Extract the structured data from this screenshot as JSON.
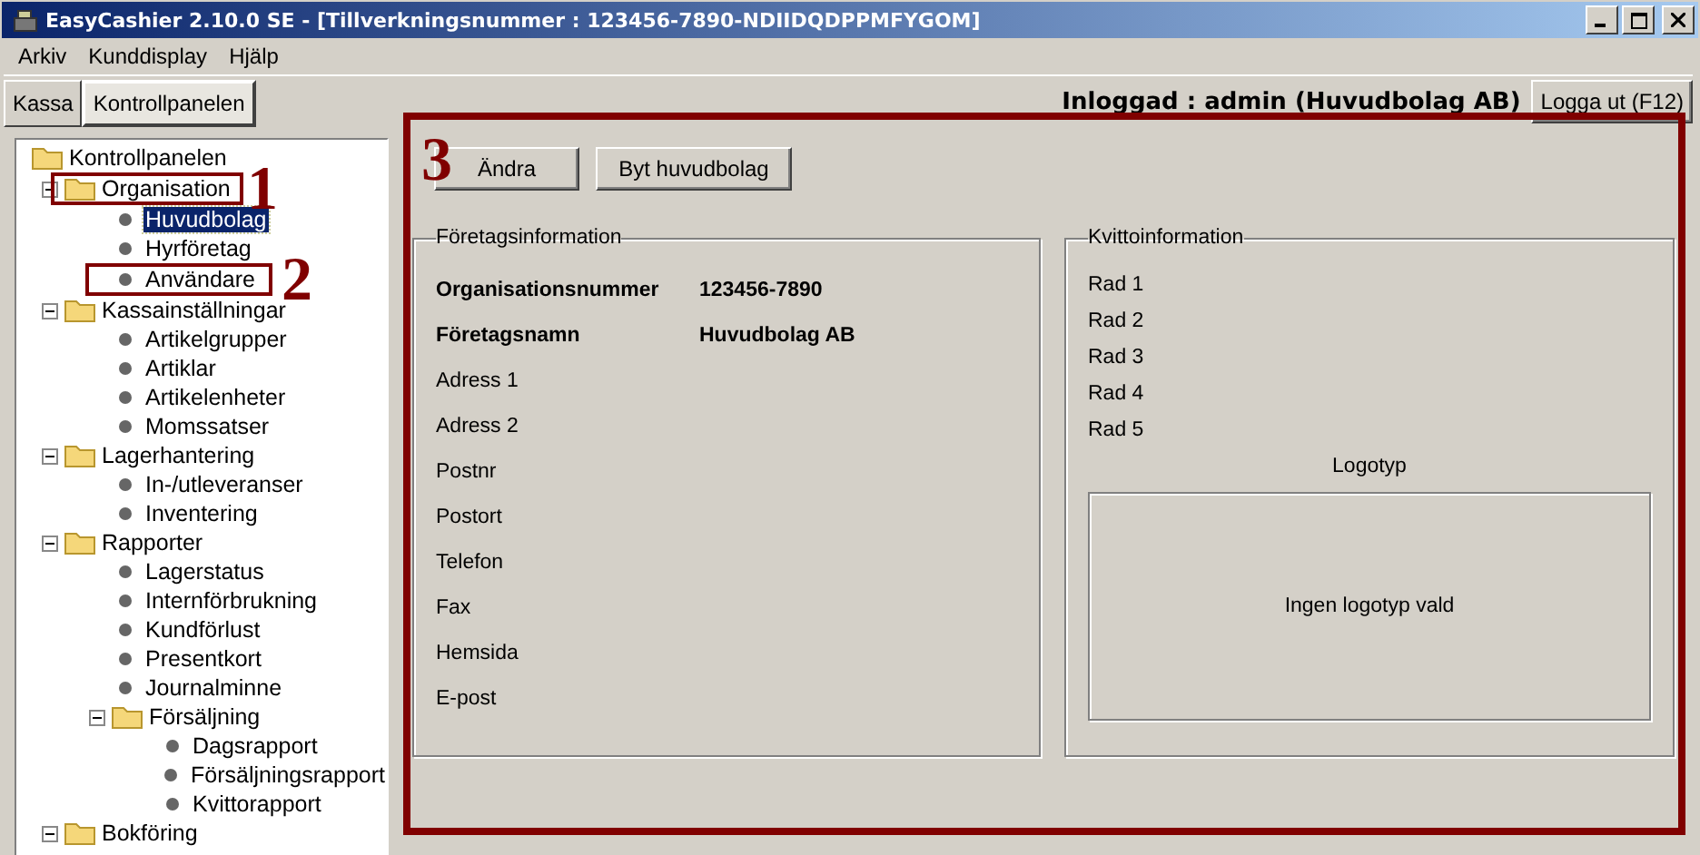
{
  "window": {
    "title": "EasyCashier 2.10.0 SE - [Tillverkningsnummer : 123456-7890-NDIIDQDPPMFYGOM]"
  },
  "menu": [
    "Arkiv",
    "Kunddisplay",
    "Hjälp"
  ],
  "tabs": [
    {
      "label": "Kassa",
      "selected": false
    },
    {
      "label": "Kontrollpanelen",
      "selected": true
    }
  ],
  "login_status": "Inloggad : admin (Huvudbolag AB)",
  "logout_button": "Logga ut (F12)",
  "tree": [
    {
      "label": "Kontrollpanelen",
      "kind": "folder",
      "selected": false,
      "children": [
        {
          "label": "Organisation",
          "kind": "folder",
          "expanded": true,
          "selected": false,
          "children": [
            {
              "label": "Huvudbolag",
              "kind": "leaf",
              "selected": true
            },
            {
              "label": "Hyrföretag",
              "kind": "leaf",
              "selected": false
            },
            {
              "label": "Användare",
              "kind": "leaf",
              "selected": false
            }
          ]
        },
        {
          "label": "Kassainställningar",
          "kind": "folder",
          "expanded": true,
          "selected": false,
          "children": [
            {
              "label": "Artikelgrupper",
              "kind": "leaf",
              "selected": false
            },
            {
              "label": "Artiklar",
              "kind": "leaf",
              "selected": false
            },
            {
              "label": "Artikelenheter",
              "kind": "leaf",
              "selected": false
            },
            {
              "label": "Momssatser",
              "kind": "leaf",
              "selected": false
            }
          ]
        },
        {
          "label": "Lagerhantering",
          "kind": "folder",
          "expanded": true,
          "selected": false,
          "children": [
            {
              "label": "In-/utleveranser",
              "kind": "leaf",
              "selected": false
            },
            {
              "label": "Inventering",
              "kind": "leaf",
              "selected": false
            }
          ]
        },
        {
          "label": "Rapporter",
          "kind": "folder",
          "expanded": true,
          "selected": false,
          "children": [
            {
              "label": "Lagerstatus",
              "kind": "leaf",
              "selected": false
            },
            {
              "label": "Internförbrukning",
              "kind": "leaf",
              "selected": false
            },
            {
              "label": "Kundförlust",
              "kind": "leaf",
              "selected": false
            },
            {
              "label": "Presentkort",
              "kind": "leaf",
              "selected": false
            },
            {
              "label": "Journalminne",
              "kind": "leaf",
              "selected": false
            },
            {
              "label": "Försäljning",
              "kind": "folder",
              "expanded": true,
              "selected": false,
              "children": [
                {
                  "label": "Dagsrapport",
                  "kind": "leaf",
                  "selected": false
                },
                {
                  "label": "Försäljningsrapport",
                  "kind": "leaf",
                  "selected": false
                },
                {
                  "label": "Kvittorapport",
                  "kind": "leaf",
                  "selected": false
                }
              ]
            }
          ]
        },
        {
          "label": "Bokföring",
          "kind": "folder",
          "expanded": true,
          "selected": false
        }
      ]
    }
  ],
  "toolbar": [
    "Ändra",
    "Byt huvudbolag"
  ],
  "company_info": {
    "title": "Företagsinformation",
    "fields": [
      {
        "label": "Organisationsnummer",
        "value": "123456-7890",
        "bold": true
      },
      {
        "label": "Företagsnamn",
        "value": "Huvudbolag AB",
        "bold": true
      },
      {
        "label": "Adress 1",
        "bold": false
      },
      {
        "label": "Adress 2",
        "bold": false
      },
      {
        "label": "Postnr",
        "bold": false
      },
      {
        "label": "Postort",
        "bold": false
      },
      {
        "label": "Telefon",
        "bold": false
      },
      {
        "label": "Fax",
        "bold": false
      },
      {
        "label": "Hemsida",
        "bold": false
      },
      {
        "label": "E-post",
        "bold": false
      }
    ]
  },
  "receipt_info": {
    "title": "Kvittoinformation",
    "rows": [
      "Rad 1",
      "Rad 2",
      "Rad 3",
      "Rad 4",
      "Rad 5"
    ],
    "logo_label": "Logotyp",
    "logo_placeholder": "Ingen logotyp vald"
  },
  "annotations": [
    {
      "label": "1"
    },
    {
      "label": "2"
    },
    {
      "label": "3"
    }
  ]
}
